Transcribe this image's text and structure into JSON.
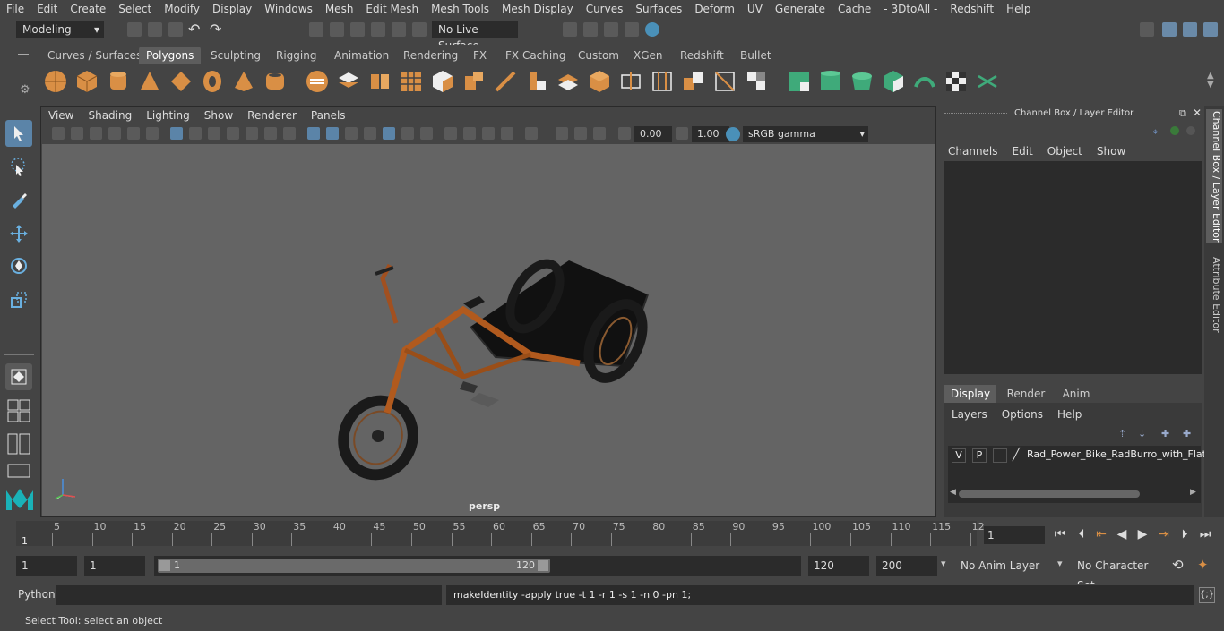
{
  "menubar": {
    "items": [
      "File",
      "Edit",
      "Create",
      "Select",
      "Modify",
      "Display",
      "Windows",
      "Mesh",
      "Edit Mesh",
      "Mesh Tools",
      "Mesh Display",
      "Curves",
      "Surfaces",
      "Deform",
      "UV",
      "Generate",
      "Cache",
      "- 3DtoAll -",
      "Redshift",
      "Help"
    ]
  },
  "statusline": {
    "mode": "Modeling",
    "live_surface": "No Live Surface"
  },
  "shelf": {
    "tabs": [
      "Curves / Surfaces",
      "Polygons",
      "Sculpting",
      "Rigging",
      "Animation",
      "Rendering",
      "FX",
      "FX Caching",
      "Custom",
      "XGen",
      "Redshift",
      "Bullet"
    ],
    "active_tab": "Polygons"
  },
  "viewport": {
    "menu": [
      "View",
      "Shading",
      "Lighting",
      "Show",
      "Renderer",
      "Panels"
    ],
    "exposure": "0.00",
    "gamma": "1.00",
    "color_space": "sRGB gamma",
    "camera_label": "persp"
  },
  "channel_box": {
    "title": "Channel Box / Layer Editor",
    "menu": [
      "Channels",
      "Edit",
      "Object",
      "Show"
    ]
  },
  "layer_editor": {
    "tabs": [
      "Display",
      "Render",
      "Anim"
    ],
    "active_tab": "Display",
    "menu": [
      "Layers",
      "Options",
      "Help"
    ],
    "layer": {
      "v": "V",
      "p": "P",
      "name": "Rad_Power_Bike_RadBurro_with_Flat"
    }
  },
  "side_tabs": [
    "Channel Box / Layer Editor",
    "Attribute Editor"
  ],
  "timeline": {
    "ticks": [
      "5",
      "10",
      "15",
      "20",
      "25",
      "30",
      "35",
      "40",
      "45",
      "50",
      "55",
      "60",
      "65",
      "70",
      "75",
      "80",
      "85",
      "90",
      "95",
      "100",
      "105",
      "110",
      "115",
      "12"
    ],
    "current_frame_marker": "1",
    "current_frame": "1"
  },
  "range": {
    "start": "1",
    "anim_start": "1",
    "slider_start": "1",
    "slider_end": "120",
    "end": "120",
    "anim_end": "200",
    "anim_layer": "No Anim Layer",
    "character_set": "No Character Set"
  },
  "command": {
    "language": "Python",
    "result": "makeIdentity -apply true -t 1 -r 1 -s 1 -n 0 -pn 1;"
  },
  "helpline": {
    "text": "Select Tool: select an object"
  },
  "colors": {
    "accent": "#4a90b8",
    "shelf_icon": "#d98f45",
    "shelf_icon_green": "#3faa7a",
    "viewport_bg": "#646464"
  }
}
